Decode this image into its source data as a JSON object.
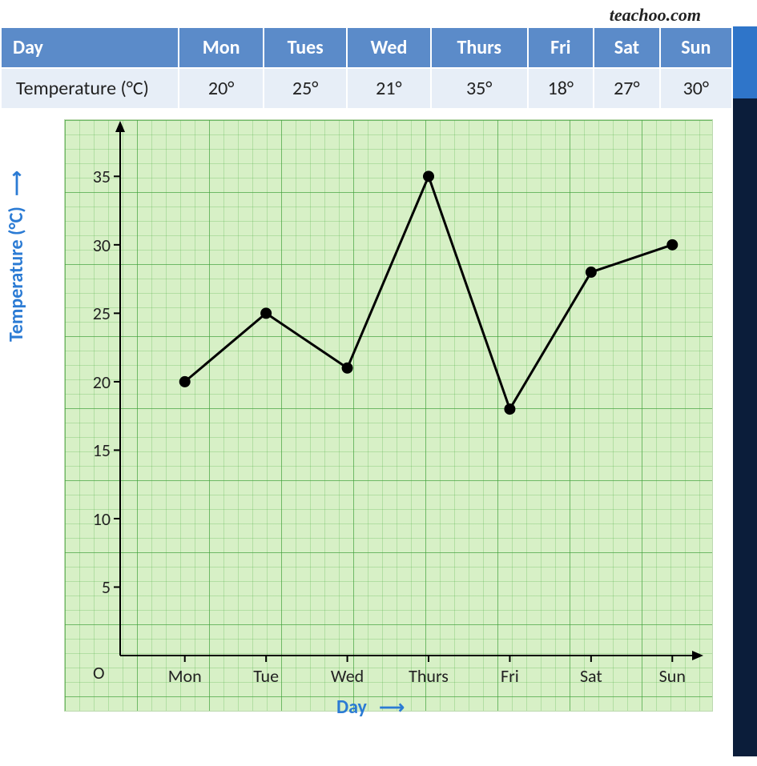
{
  "brand": "teachoo.com",
  "table": {
    "header_first": "Day",
    "headers": [
      "Mon",
      "Tues",
      "Wed",
      "Thurs",
      "Fri",
      "Sat",
      "Sun"
    ],
    "row_label": "Temperature (°C)",
    "row_values": [
      "20°",
      "25°",
      "21°",
      "35°",
      "18°",
      "27°",
      "30°"
    ]
  },
  "chart_data": {
    "type": "line",
    "categories": [
      "Mon",
      "Tue",
      "Wed",
      "Thurs",
      "Fri",
      "Sat",
      "Sun"
    ],
    "values": [
      20,
      25,
      21,
      35,
      18,
      28,
      30
    ],
    "xlabel": "Day",
    "ylabel": "Temperature (°C)",
    "yticks": [
      5,
      10,
      15,
      20,
      25,
      30,
      35
    ],
    "ylim": [
      0,
      38
    ],
    "origin_label": "O"
  }
}
